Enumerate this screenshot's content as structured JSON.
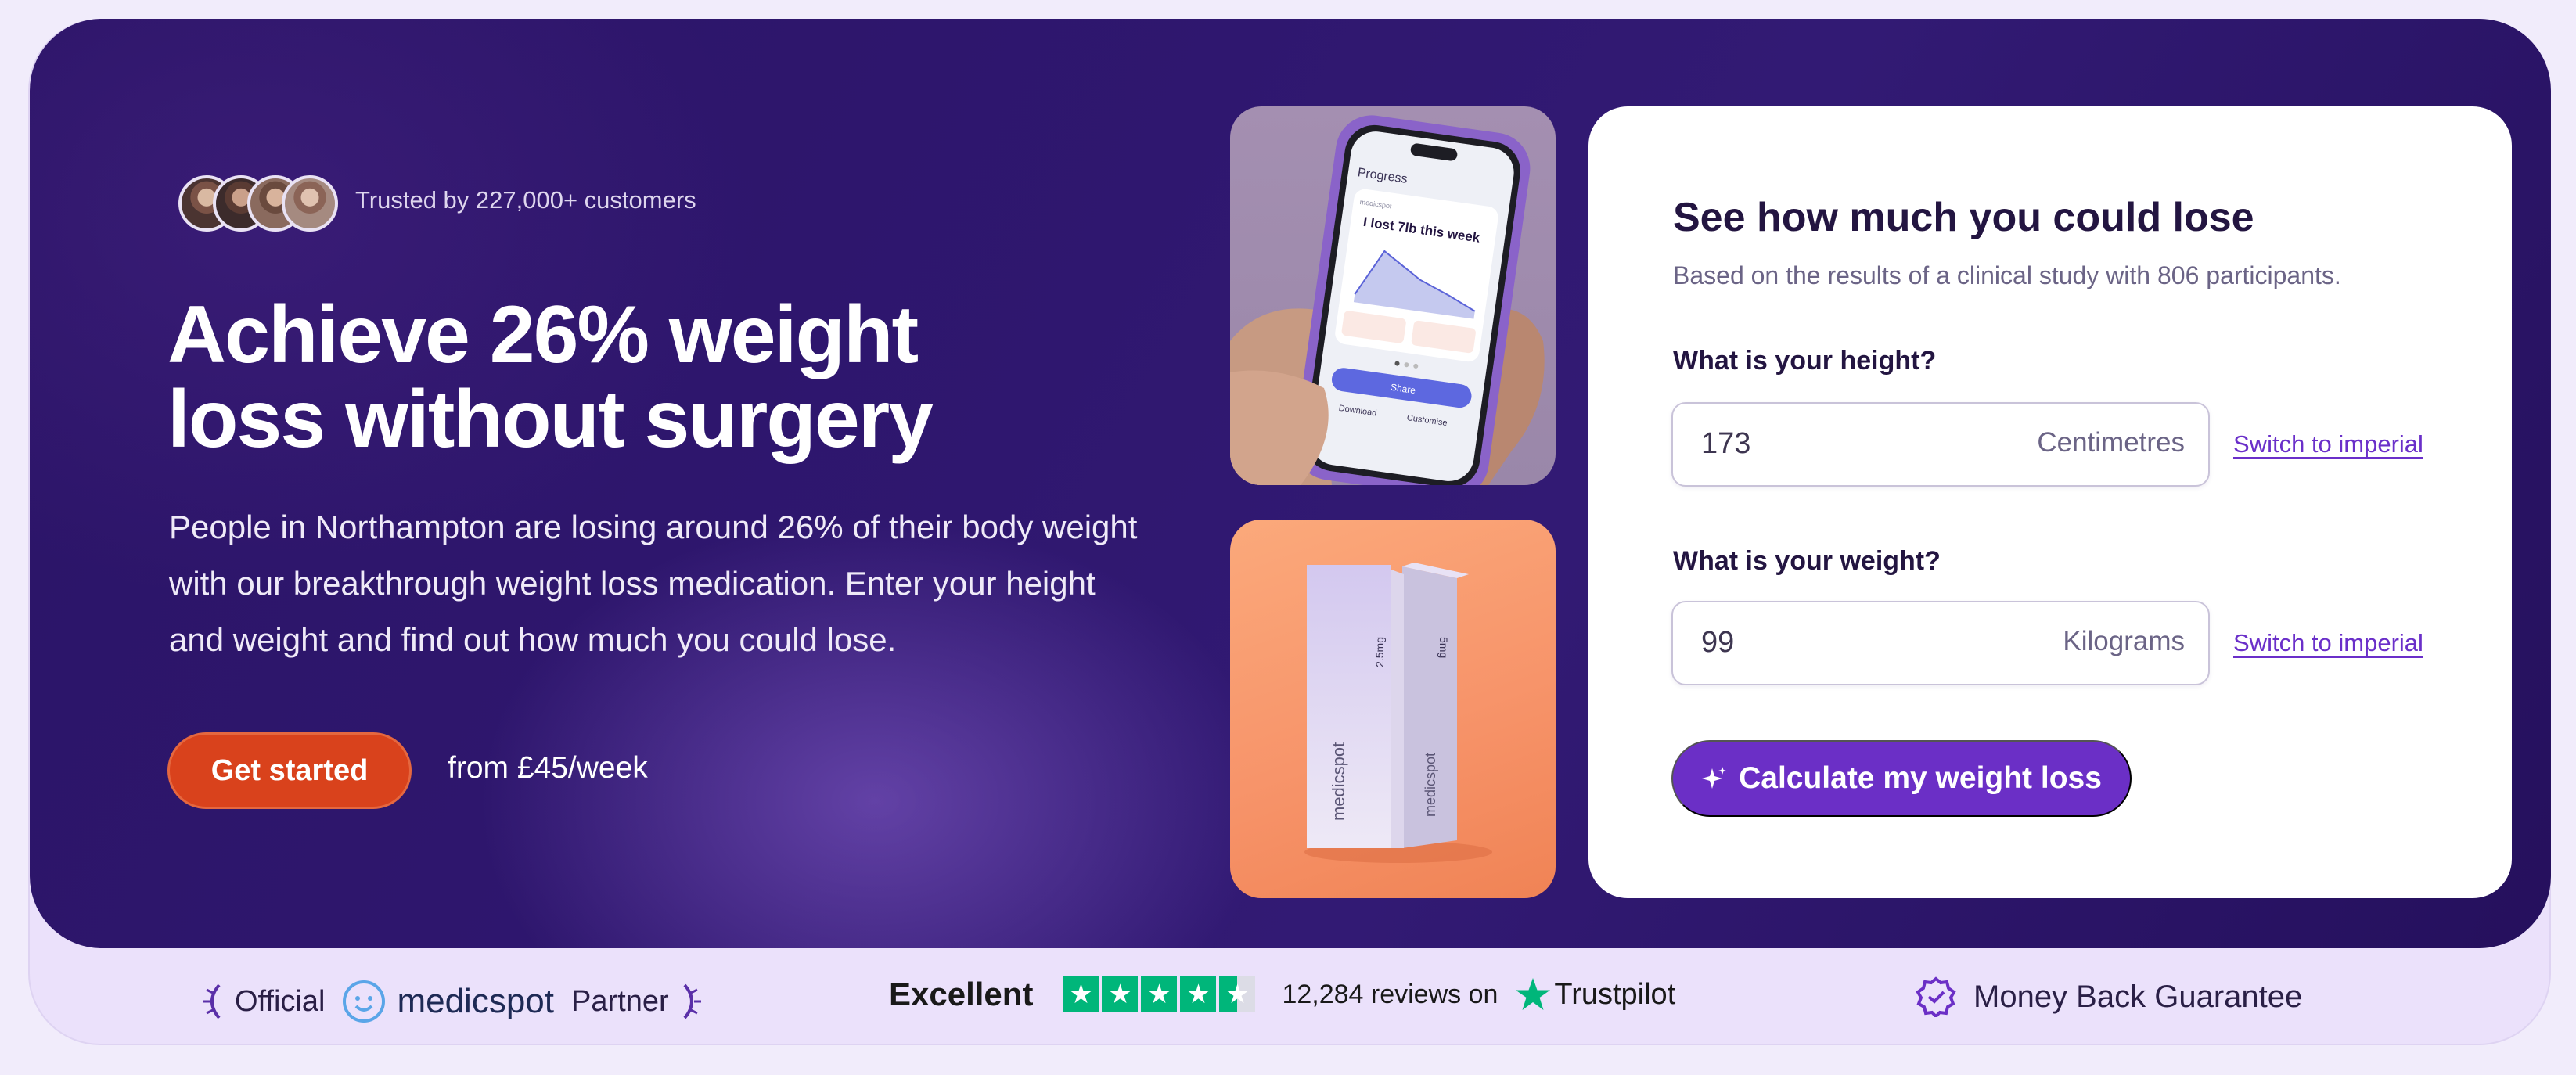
{
  "hero": {
    "trusted_text": "Trusted by 227,000+ customers",
    "headline_line1": "Achieve 26% weight",
    "headline_line2": "loss without surgery",
    "subtext": "People in Northampton are losing around 26% of their body weight with our breakthrough weight loss medication. Enter your height and weight and find out how much you could lose.",
    "cta_label": "Get started",
    "price_note": "from £45/week"
  },
  "phone_mockup": {
    "screen_title": "Progress",
    "brand": "medicspot",
    "headline": "I lost 7lb this week",
    "share_label": "Share",
    "download_label": "Download",
    "customise_label": "Customise"
  },
  "product_box": {
    "brand": "medicspot",
    "dose_front": "2.5mg",
    "dose_back": "5mg"
  },
  "calculator": {
    "title": "See how much you could lose",
    "subtitle": "Based on the results of a clinical study with 806 participants.",
    "height": {
      "label": "What is your height?",
      "value": "173",
      "unit": "Centimetres",
      "switch_label": "Switch to imperial"
    },
    "weight": {
      "label": "What is your weight?",
      "value": "99",
      "unit": "Kilograms",
      "switch_label": "Switch to imperial"
    },
    "button_label": "Calculate my weight loss"
  },
  "footer": {
    "official_label": "Official",
    "brand_name": "medicspot",
    "partner_label": "Partner",
    "rating_label": "Excellent",
    "stars": 4.5,
    "reviews_text": "12,284 reviews on",
    "trustpilot_label": "Trustpilot",
    "guarantee_label": "Money Back Guarantee"
  },
  "colors": {
    "hero_bg": "#2b1467",
    "cta_orange": "#d9421c",
    "accent_purple": "#6b2fc6",
    "trustpilot_green": "#00b67a"
  }
}
